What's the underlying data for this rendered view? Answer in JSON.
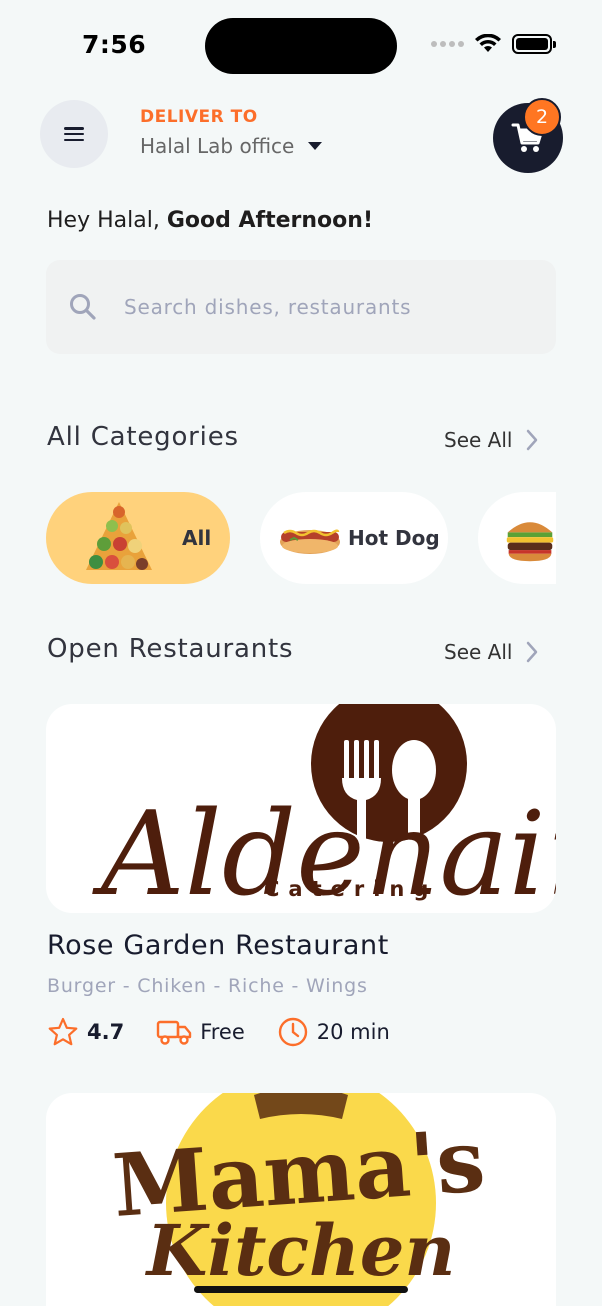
{
  "status_bar": {
    "time": "7:56"
  },
  "header": {
    "deliver_label": "DELIVER TO",
    "location": "Halal Lab office",
    "cart_count": "2"
  },
  "greeting": {
    "prefix": "Hey Halal, ",
    "bold": "Good Afternoon!"
  },
  "search": {
    "placeholder": "Search dishes, restaurants"
  },
  "categories": {
    "title": "All Categories",
    "see_all": "See All",
    "items": [
      {
        "label": "All",
        "icon": "food-pyramid-icon",
        "selected": true
      },
      {
        "label": "Hot Dog",
        "icon": "hot-dog-icon",
        "selected": false
      },
      {
        "label": "",
        "icon": "burger-icon",
        "selected": false
      }
    ]
  },
  "restaurants": {
    "title": "Open Restaurants",
    "see_all": "See All",
    "items": [
      {
        "logo_text": "Aldenaire",
        "logo_subtext": "Catering",
        "name": "Rose Garden Restaurant",
        "tags": "Burger - Chiken - Riche - Wings",
        "rating": "4.7",
        "delivery": "Free",
        "time": "20 min"
      },
      {
        "logo_text": "Mama's",
        "logo_subtext": "Kitchen"
      }
    ]
  },
  "colors": {
    "accent": "#FC6E2A",
    "dark": "#181C2E",
    "selected_category": "#FFD27C",
    "background": "#F4F8F8"
  }
}
